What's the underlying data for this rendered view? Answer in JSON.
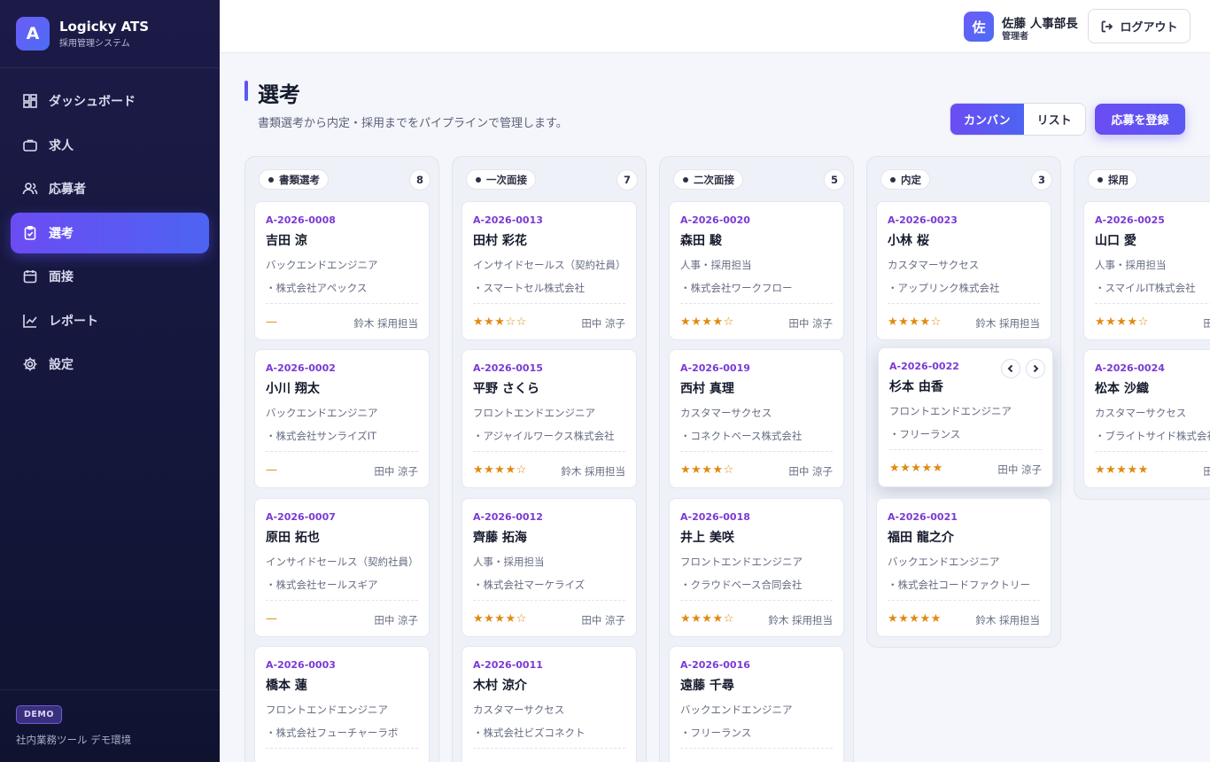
{
  "app": {
    "name": "Logicky ATS",
    "subtitle": "採用管理システム",
    "logo_letter": "A"
  },
  "sidebar": {
    "items": [
      {
        "label": "ダッシュボード",
        "icon": "dashboard-icon",
        "active": false
      },
      {
        "label": "求人",
        "icon": "briefcase-icon",
        "active": false
      },
      {
        "label": "応募者",
        "icon": "users-icon",
        "active": false
      },
      {
        "label": "選考",
        "icon": "clipboard-icon",
        "active": true
      },
      {
        "label": "面接",
        "icon": "calendar-icon",
        "active": false
      },
      {
        "label": "レポート",
        "icon": "chart-line-icon",
        "active": false
      },
      {
        "label": "設定",
        "icon": "gear-icon",
        "active": false
      }
    ],
    "footer": {
      "badge": "DEMO",
      "text": "社内業務ツール デモ環境"
    }
  },
  "header": {
    "avatar_letter": "佐",
    "user_name": "佐藤 人事部長",
    "user_role": "管理者",
    "logout_label": "ログアウト"
  },
  "page": {
    "title": "選考",
    "description": "書類選考から内定・採用までをパイプラインで管理します。",
    "view_toggle": {
      "kanban": "カンバン",
      "list": "リスト",
      "selected": "カンバン"
    },
    "register_button": "応募を登録"
  },
  "colors": {
    "accent": "#6b4cf3",
    "accent2": "#4d64f2",
    "star": "#e08a12",
    "id": "#7a3ad6",
    "sidebar_bg": "#1c1b48"
  },
  "columns": [
    {
      "name": "書類選考",
      "count": "8",
      "cards": [
        {
          "id": "A-2026-0008",
          "name": "吉田 涼",
          "role": "バックエンドエンジニア",
          "company": "・株式会社アペックス",
          "rating": "—",
          "owner": "鈴木 採用担当"
        },
        {
          "id": "A-2026-0002",
          "name": "小川 翔太",
          "role": "バックエンドエンジニア",
          "company": "・株式会社サンライズIT",
          "rating": "—",
          "owner": "田中 涼子"
        },
        {
          "id": "A-2026-0007",
          "name": "原田 拓也",
          "role": "インサイドセールス（契約社員）",
          "company": "・株式会社セールスギア",
          "rating": "—",
          "owner": "田中 涼子"
        },
        {
          "id": "A-2026-0003",
          "name": "橋本 蓮",
          "role": "フロントエンドエンジニア",
          "company": "・株式会社フューチャーラボ",
          "rating": "",
          "owner": ""
        }
      ]
    },
    {
      "name": "一次面接",
      "count": "7",
      "cards": [
        {
          "id": "A-2026-0013",
          "name": "田村 彩花",
          "role": "インサイドセールス（契約社員）",
          "company": "・スマートセル株式会社",
          "rating": "★★★☆☆",
          "owner": "田中 涼子"
        },
        {
          "id": "A-2026-0015",
          "name": "平野 さくら",
          "role": "フロントエンドエンジニア",
          "company": "・アジャイルワークス株式会社",
          "rating": "★★★★☆",
          "owner": "鈴木 採用担当"
        },
        {
          "id": "A-2026-0012",
          "name": "齊藤 拓海",
          "role": "人事・採用担当",
          "company": "・株式会社マーケライズ",
          "rating": "★★★★☆",
          "owner": "田中 涼子"
        },
        {
          "id": "A-2026-0011",
          "name": "木村 涼介",
          "role": "カスタマーサクセス",
          "company": "・株式会社ビズコネクト",
          "rating": "",
          "owner": ""
        }
      ]
    },
    {
      "name": "二次面接",
      "count": "5",
      "cards": [
        {
          "id": "A-2026-0020",
          "name": "森田 駿",
          "role": "人事・採用担当",
          "company": "・株式会社ワークフロー",
          "rating": "★★★★☆",
          "owner": "田中 涼子"
        },
        {
          "id": "A-2026-0019",
          "name": "西村 真理",
          "role": "カスタマーサクセス",
          "company": "・コネクトベース株式会社",
          "rating": "★★★★☆",
          "owner": "田中 涼子"
        },
        {
          "id": "A-2026-0018",
          "name": "井上 美咲",
          "role": "フロントエンドエンジニア",
          "company": "・クラウドベース合同会社",
          "rating": "★★★★☆",
          "owner": "鈴木 採用担当"
        },
        {
          "id": "A-2026-0016",
          "name": "遠藤 千尋",
          "role": "バックエンドエンジニア",
          "company": "・フリーランス",
          "rating": "",
          "owner": ""
        }
      ]
    },
    {
      "name": "内定",
      "count": "3",
      "cards": [
        {
          "id": "A-2026-0023",
          "name": "小林 桜",
          "role": "カスタマーサクセス",
          "company": "・アップリンク株式会社",
          "rating": "★★★★☆",
          "owner": "鈴木 採用担当"
        },
        {
          "id": "A-2026-0022",
          "name": "杉本 由香",
          "role": "フロントエンドエンジニア",
          "company": "・フリーランス",
          "rating": "★★★★★",
          "owner": "田中 涼子",
          "focused": true
        },
        {
          "id": "A-2026-0021",
          "name": "福田 龍之介",
          "role": "バックエンドエンジニア",
          "company": "・株式会社コードファクトリー",
          "rating": "★★★★★",
          "owner": "鈴木 採用担当"
        }
      ]
    },
    {
      "name": "採用",
      "count": "",
      "cards": [
        {
          "id": "A-2026-0025",
          "name": "山口 愛",
          "role": "人事・採用担当",
          "company": "・スマイルIT株式会社",
          "rating": "★★★★☆",
          "owner": "田中 涼子"
        },
        {
          "id": "A-2026-0024",
          "name": "松本 沙織",
          "role": "カスタマーサクセス",
          "company": "・ブライトサイド株式会社",
          "rating": "★★★★★",
          "owner": "田中 涼子"
        }
      ]
    }
  ]
}
